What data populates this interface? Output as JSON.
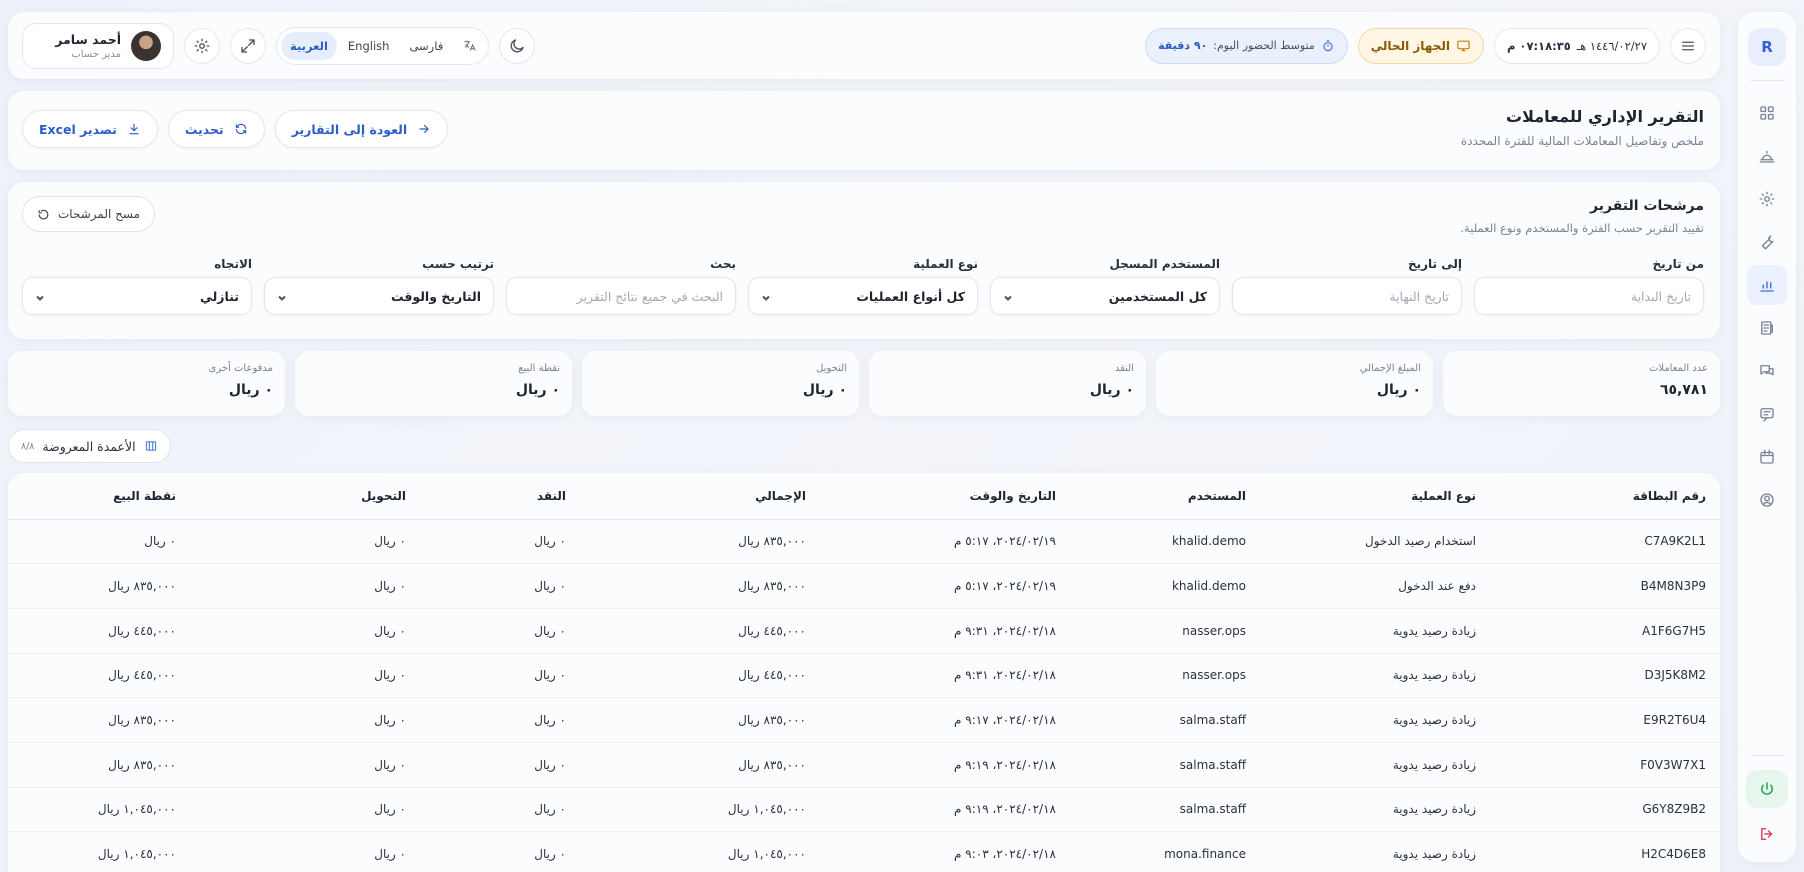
{
  "sidebar": {
    "logo": "R"
  },
  "topbar": {
    "date": "١٤٤٦/٠٢/٢٧ هـ",
    "time": "٠٧:١٨:٣٥ م",
    "device_label": "الجهاز الحالي",
    "attendance_label": "متوسط الحضور اليوم:",
    "attendance_value": "٩٠ دقيقة",
    "languages": [
      "العربية",
      "English",
      "فارسی"
    ],
    "user_name": "أحمد سامر",
    "user_role": "مدير حساب"
  },
  "header": {
    "title": "التقرير الإداري للمعاملات",
    "subtitle": "ملخص وتفاصيل المعاملات المالية للفترة المحددة",
    "back_label": "العودة إلى التقارير",
    "refresh_label": "تحديث",
    "export_label": "تصدير Excel"
  },
  "filters": {
    "title": "مرشحات التقرير",
    "subtitle": "تقييد التقرير حسب الفترة والمستخدم ونوع العملية.",
    "clear_label": "مسح المرشحات",
    "from_label": "من تاريخ",
    "from_placeholder": "تاريخ البداية",
    "to_label": "إلى تاريخ",
    "to_placeholder": "تاريخ النهاية",
    "user_label": "المستخدم المسجل",
    "user_value": "كل المستخدمين",
    "type_label": "نوع العملية",
    "type_value": "كل أنواع العمليات",
    "search_label": "بحث",
    "search_placeholder": "البحث في جميع نتائج التقرير",
    "sort_label": "ترتيب حسب",
    "sort_value": "التاريخ والوقت",
    "dir_label": "الاتجاه",
    "dir_value": "تنازلي"
  },
  "stats": [
    {
      "label": "عدد المعاملات",
      "value": "٦٥,٧٨١"
    },
    {
      "label": "المبلغ الإجمالي",
      "value": "٠ ريال"
    },
    {
      "label": "النقد",
      "value": "٠ ريال"
    },
    {
      "label": "التحويل",
      "value": "٠ ريال"
    },
    {
      "label": "نقطة البيع",
      "value": "٠ ريال"
    },
    {
      "label": "مدفوعات أخرى",
      "value": "٠ ريال"
    }
  ],
  "columns_button": {
    "label": "الأعمدة المعروضة",
    "count": "٨/٨"
  },
  "table": {
    "headers": [
      "رقم البطاقة",
      "نوع العملية",
      "المستخدم",
      "التاريخ والوقت",
      "الإجمالي",
      "النقد",
      "التحويل",
      "نقطة البيع"
    ],
    "rows": [
      [
        "C7A9K2L1",
        "استخدام رصيد الدخول",
        "khalid.demo",
        "٢٠٢٤/٠٢/١٩، ٥:١٧ م",
        "٨٣٥,٠٠٠ ريال",
        "٠ ريال",
        "٠ ريال",
        "٠ ريال"
      ],
      [
        "B4M8N3P9",
        "دفع عند الدخول",
        "khalid.demo",
        "٢٠٢٤/٠٢/١٩، ٥:١٧ م",
        "٨٣٥,٠٠٠ ريال",
        "٠ ريال",
        "٠ ريال",
        "٨٣٥,٠٠٠ ريال"
      ],
      [
        "A1F6G7H5",
        "زيادة رصيد يدوية",
        "nasser.ops",
        "٢٠٢٤/٠٢/١٨، ٩:٣١ م",
        "٤٤٥,٠٠٠ ريال",
        "٠ ريال",
        "٠ ريال",
        "٤٤٥,٠٠٠ ريال"
      ],
      [
        "D3J5K8M2",
        "زيادة رصيد يدوية",
        "nasser.ops",
        "٢٠٢٤/٠٢/١٨، ٩:٣١ م",
        "٤٤٥,٠٠٠ ريال",
        "٠ ريال",
        "٠ ريال",
        "٤٤٥,٠٠٠ ريال"
      ],
      [
        "E9R2T6U4",
        "زيادة رصيد يدوية",
        "salma.staff",
        "٢٠٢٤/٠٢/١٨، ٩:١٧ م",
        "٨٣٥,٠٠٠ ريال",
        "٠ ريال",
        "٠ ريال",
        "٨٣٥,٠٠٠ ريال"
      ],
      [
        "F0V3W7X1",
        "زيادة رصيد يدوية",
        "salma.staff",
        "٢٠٢٤/٠٢/١٨، ٩:١٩ م",
        "٨٣٥,٠٠٠ ريال",
        "٠ ريال",
        "٠ ريال",
        "٨٣٥,٠٠٠ ريال"
      ],
      [
        "G6Y8Z9B2",
        "زيادة رصيد يدوية",
        "salma.staff",
        "٢٠٢٤/٠٢/١٨، ٩:١٩ م",
        "١,٠٤٥,٠٠٠ ريال",
        "٠ ريال",
        "٠ ريال",
        "١,٠٤٥,٠٠٠ ريال"
      ],
      [
        "H2C4D6E8",
        "زيادة رصيد يدوية",
        "mona.finance",
        "٢٠٢٤/٠٢/١٨، ٩:٠٣ م",
        "١,٠٤٥,٠٠٠ ريال",
        "٠ ريال",
        "٠ ريال",
        "١,٠٤٥,٠٠٠ ريال"
      ]
    ]
  }
}
